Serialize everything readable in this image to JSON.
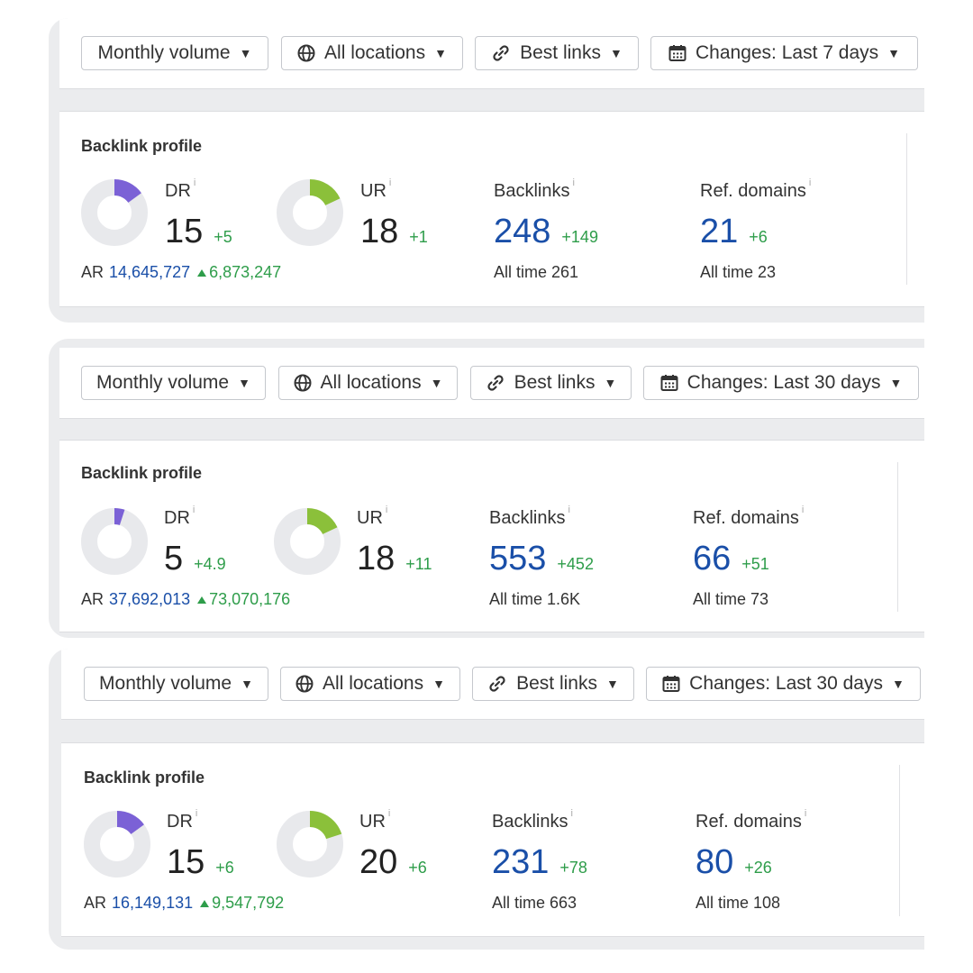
{
  "colors": {
    "dr": "#7b61d6",
    "ur": "#8bc03a",
    "ring": "#e8e9ec",
    "accent_blue": "#1a4fa8",
    "delta_green": "#2e9d4a"
  },
  "panels": [
    {
      "toolbar": {
        "volume": "Monthly volume",
        "locations": "All locations",
        "links": "Best links",
        "changes": "Changes: Last 7 days"
      },
      "profile": {
        "title": "Backlink profile",
        "dr": {
          "label": "DR",
          "info": "i",
          "value": "15",
          "delta": "+5",
          "score": 15
        },
        "ur": {
          "label": "UR",
          "info": "i",
          "value": "18",
          "delta": "+1",
          "score": 18
        },
        "ar": {
          "label": "AR",
          "value": "14,645,727",
          "delta": "6,873,247"
        },
        "backlinks": {
          "label": "Backlinks",
          "info": "i",
          "value": "248",
          "delta": "+149",
          "alltime_label": "All time",
          "alltime": "261"
        },
        "refdomains": {
          "label": "Ref. domains",
          "info": "i",
          "value": "21",
          "delta": "+6",
          "alltime_label": "All time",
          "alltime": "23"
        }
      }
    },
    {
      "toolbar": {
        "volume": "Monthly volume",
        "locations": "All locations",
        "links": "Best links",
        "changes": "Changes: Last 30 days"
      },
      "profile": {
        "title": "Backlink profile",
        "dr": {
          "label": "DR",
          "info": "i",
          "value": "5",
          "delta": "+4.9",
          "score": 5
        },
        "ur": {
          "label": "UR",
          "info": "i",
          "value": "18",
          "delta": "+11",
          "score": 18
        },
        "ar": {
          "label": "AR",
          "value": "37,692,013",
          "delta": "73,070,176"
        },
        "backlinks": {
          "label": "Backlinks",
          "info": "i",
          "value": "553",
          "delta": "+452",
          "alltime_label": "All time",
          "alltime": "1.6K"
        },
        "refdomains": {
          "label": "Ref. domains",
          "info": "i",
          "value": "66",
          "delta": "+51",
          "alltime_label": "All time",
          "alltime": "73"
        }
      }
    },
    {
      "toolbar": {
        "volume": "Monthly volume",
        "locations": "All locations",
        "links": "Best links",
        "changes": "Changes: Last 30 days"
      },
      "profile": {
        "title": "Backlink profile",
        "dr": {
          "label": "DR",
          "info": "i",
          "value": "15",
          "delta": "+6",
          "score": 15
        },
        "ur": {
          "label": "UR",
          "info": "i",
          "value": "20",
          "delta": "+6",
          "score": 20
        },
        "ar": {
          "label": "AR",
          "value": "16,149,131",
          "delta": "9,547,792"
        },
        "backlinks": {
          "label": "Backlinks",
          "info": "i",
          "value": "231",
          "delta": "+78",
          "alltime_label": "All time",
          "alltime": "663"
        },
        "refdomains": {
          "label": "Ref. domains",
          "info": "i",
          "value": "80",
          "delta": "+26",
          "alltime_label": "All time",
          "alltime": "108"
        }
      }
    }
  ]
}
